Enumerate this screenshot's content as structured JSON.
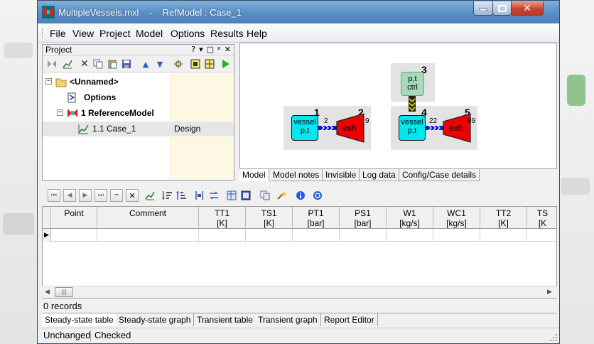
{
  "window": {
    "title": "MultipleVessels.mxl    -    RefModel : Case_1"
  },
  "menu": [
    "File",
    "View",
    "Project",
    "Model",
    "Options",
    "Results",
    "Help"
  ],
  "project_panel": {
    "title": "Project",
    "header_buttons": [
      "?",
      "▾",
      "□",
      "ᵖ",
      "✕"
    ],
    "tree": [
      {
        "label": "<Unnamed>",
        "value": ""
      },
      {
        "label": "Options",
        "value": ""
      },
      {
        "label": "1 ReferenceModel",
        "value": ""
      },
      {
        "label": "1.1 Case_1",
        "value": "Design"
      }
    ]
  },
  "model": {
    "left_group": {
      "vessel": {
        "num": "1",
        "line1": "vessel",
        "line2": "p,t"
      },
      "link_num": "2",
      "exh": {
        "num": "2",
        "label": "exh",
        "station": "9"
      }
    },
    "right_group": {
      "ctrl": {
        "num": "3",
        "line1": "p,t",
        "line2": "ctrl"
      },
      "vessel": {
        "num": "4",
        "line1": "vessel",
        "line2": "p,t"
      },
      "link_num": "22",
      "exh": {
        "num": "5",
        "label": "exh",
        "station": "99"
      }
    },
    "colors": {
      "vessel": "#00e7ef",
      "exh": "#ee0000",
      "link": "#1010d8",
      "ctrl": "#a8d8b8"
    },
    "tabs": [
      "Model",
      "Model notes",
      "Invisible",
      "Log data",
      "Config/Case details"
    ]
  },
  "grid": {
    "columns": [
      {
        "name": "Point",
        "unit": ""
      },
      {
        "name": "Comment",
        "unit": ""
      },
      {
        "name": "TT1",
        "unit": "[K]"
      },
      {
        "name": "TS1",
        "unit": "[K]"
      },
      {
        "name": "PT1",
        "unit": "[bar]"
      },
      {
        "name": "PS1",
        "unit": "[bar]"
      },
      {
        "name": "W1",
        "unit": "[kg/s]"
      },
      {
        "name": "WC1",
        "unit": "[kg/s]"
      },
      {
        "name": "TT2",
        "unit": "[K]"
      },
      {
        "name": "TS",
        "unit": "[K"
      }
    ],
    "row_marker": "▶"
  },
  "records": "0  records",
  "result_tabs": [
    "Steady-state table",
    "Steady-state graph",
    "Transient table",
    "Transient graph",
    "Report Editor"
  ],
  "status": {
    "left": "Unchanged",
    "right": "Checked"
  }
}
